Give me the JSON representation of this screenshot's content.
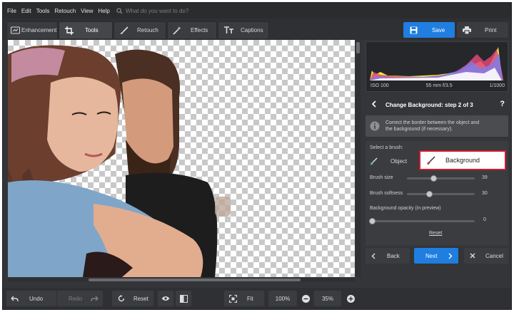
{
  "menu": {
    "items": [
      "File",
      "Edit",
      "Tools",
      "Retouch",
      "View",
      "Help"
    ],
    "search_placeholder": "What do you want to do?"
  },
  "toolbar": {
    "tabs": [
      {
        "label": "Enhancement",
        "icon": "enhancement-icon",
        "active": false
      },
      {
        "label": "Tools",
        "icon": "crop-icon",
        "active": true
      },
      {
        "label": "Retouch",
        "icon": "brush-icon",
        "active": false
      },
      {
        "label": "Effects",
        "icon": "magic-wand-icon",
        "active": false
      },
      {
        "label": "Captions",
        "icon": "text-icon",
        "active": false
      }
    ],
    "save_label": "Save",
    "print_label": "Print"
  },
  "histogram": {
    "iso": "ISO 100",
    "lens": "55 mm f/3.5",
    "shutter": "1/1000"
  },
  "panel": {
    "step_title": "Change Background: step 2 of 3",
    "help": "?",
    "info_text_line1": "Correct the border between the object and",
    "info_text_line2": "the background (if necessary).",
    "select_brush_label": "Select a brush:",
    "object_label": "Object",
    "background_label": "Background",
    "brush_size_label": "Brush size",
    "brush_size_value": "39",
    "brush_softness_label": "Brush softness",
    "brush_softness_value": "30",
    "bg_opacity_label": "Background opacity (in preview)",
    "bg_opacity_value": "0",
    "reset_link": "Reset",
    "back_label": "Back",
    "next_label": "Next",
    "cancel_label": "Cancel"
  },
  "sliders": {
    "brush_size_fraction": 0.39,
    "brush_softness_fraction": 0.3,
    "bg_opacity_fraction": 0.0
  },
  "bottom": {
    "undo": "Undo",
    "redo": "Redo",
    "reset": "Reset",
    "fit": "Fit",
    "zoom_100": "100%",
    "zoom_current": "35%"
  },
  "colors": {
    "accent": "#1f7ee0",
    "highlight_border": "#d11a2a"
  }
}
